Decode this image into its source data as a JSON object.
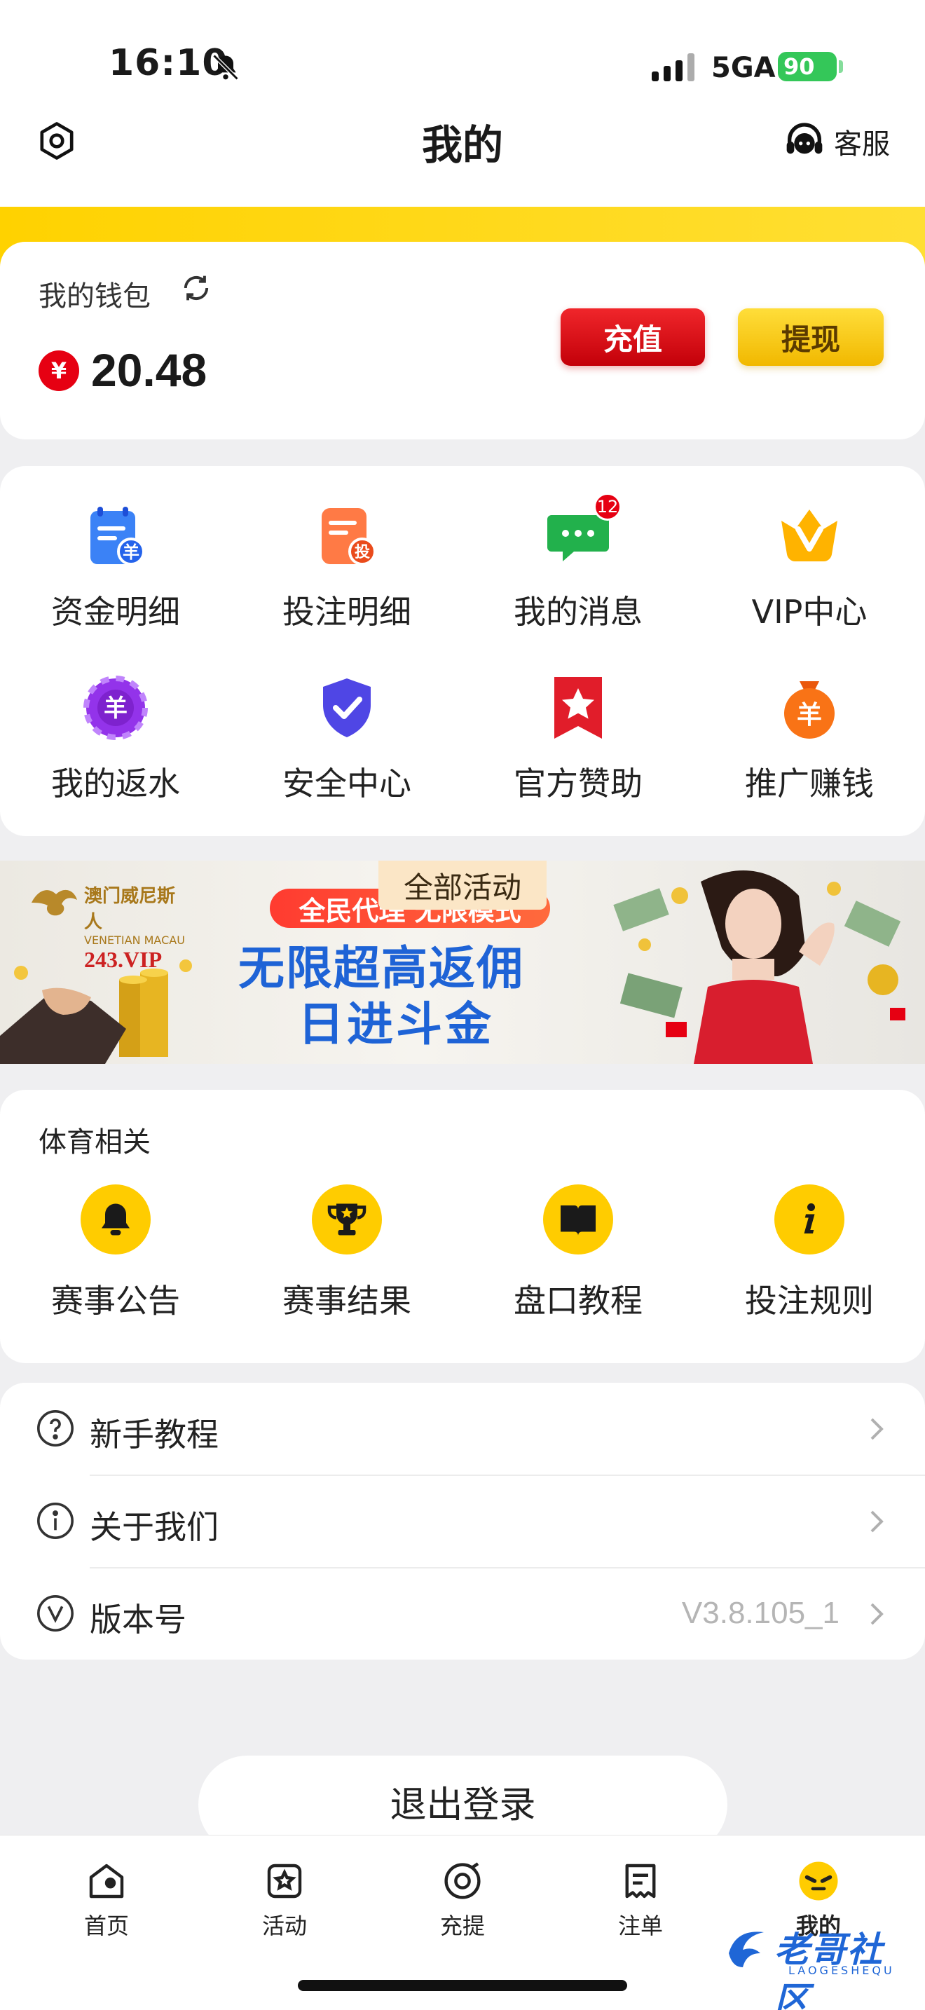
{
  "status_bar": {
    "time": "16:10",
    "network": "5GA",
    "battery": "90"
  },
  "header": {
    "title": "我的",
    "service_label": "客服"
  },
  "wallet": {
    "label": "我的钱包",
    "currency_symbol": "¥",
    "balance": "20.48",
    "recharge_label": "充值",
    "withdraw_label": "提现"
  },
  "grid": [
    {
      "label": "资金明细",
      "icon": "funds-detail-icon"
    },
    {
      "label": "投注明细",
      "icon": "bet-detail-icon"
    },
    {
      "label": "我的消息",
      "icon": "message-icon",
      "badge": "12"
    },
    {
      "label": "VIP中心",
      "icon": "vip-icon"
    },
    {
      "label": "我的返水",
      "icon": "rebate-icon"
    },
    {
      "label": "安全中心",
      "icon": "security-shield-icon"
    },
    {
      "label": "官方赞助",
      "icon": "sponsor-star-icon"
    },
    {
      "label": "推广赚钱",
      "icon": "promote-earn-icon"
    }
  ],
  "banner": {
    "tag": "全部活动",
    "brand_cn": "澳门威尼斯人",
    "brand_en": "VENETIAN MACAU",
    "brand_site": "243.VIP",
    "promo": "全民代理 无限模式",
    "line1": "无限超高返佣",
    "line2": "日进斗金"
  },
  "sports": {
    "title": "体育相关",
    "items": [
      {
        "label": "赛事公告",
        "icon": "bell-icon"
      },
      {
        "label": "赛事结果",
        "icon": "trophy-icon"
      },
      {
        "label": "盘口教程",
        "icon": "book-icon"
      },
      {
        "label": "投注规则",
        "icon": "info-icon"
      }
    ]
  },
  "list": [
    {
      "label": "新手教程",
      "icon": "question-icon",
      "value": ""
    },
    {
      "label": "关于我们",
      "icon": "info-circle-icon",
      "value": ""
    },
    {
      "label": "版本号",
      "icon": "version-icon",
      "value": "V3.8.105_1"
    }
  ],
  "logout_label": "退出登录",
  "tabs": [
    {
      "label": "首页",
      "icon": "home-icon",
      "active": false
    },
    {
      "label": "活动",
      "icon": "activity-icon",
      "active": false
    },
    {
      "label": "充提",
      "icon": "deposit-withdraw-icon",
      "active": false
    },
    {
      "label": "注单",
      "icon": "bet-slip-icon",
      "active": false
    },
    {
      "label": "我的",
      "icon": "profile-icon",
      "active": true
    }
  ],
  "watermark": {
    "text": "老哥社区",
    "sub": "LAOGESHEQU"
  },
  "colors": {
    "accent_yellow": "#ffcc00",
    "accent_red": "#e60012",
    "link_blue": "#1e63d6"
  }
}
